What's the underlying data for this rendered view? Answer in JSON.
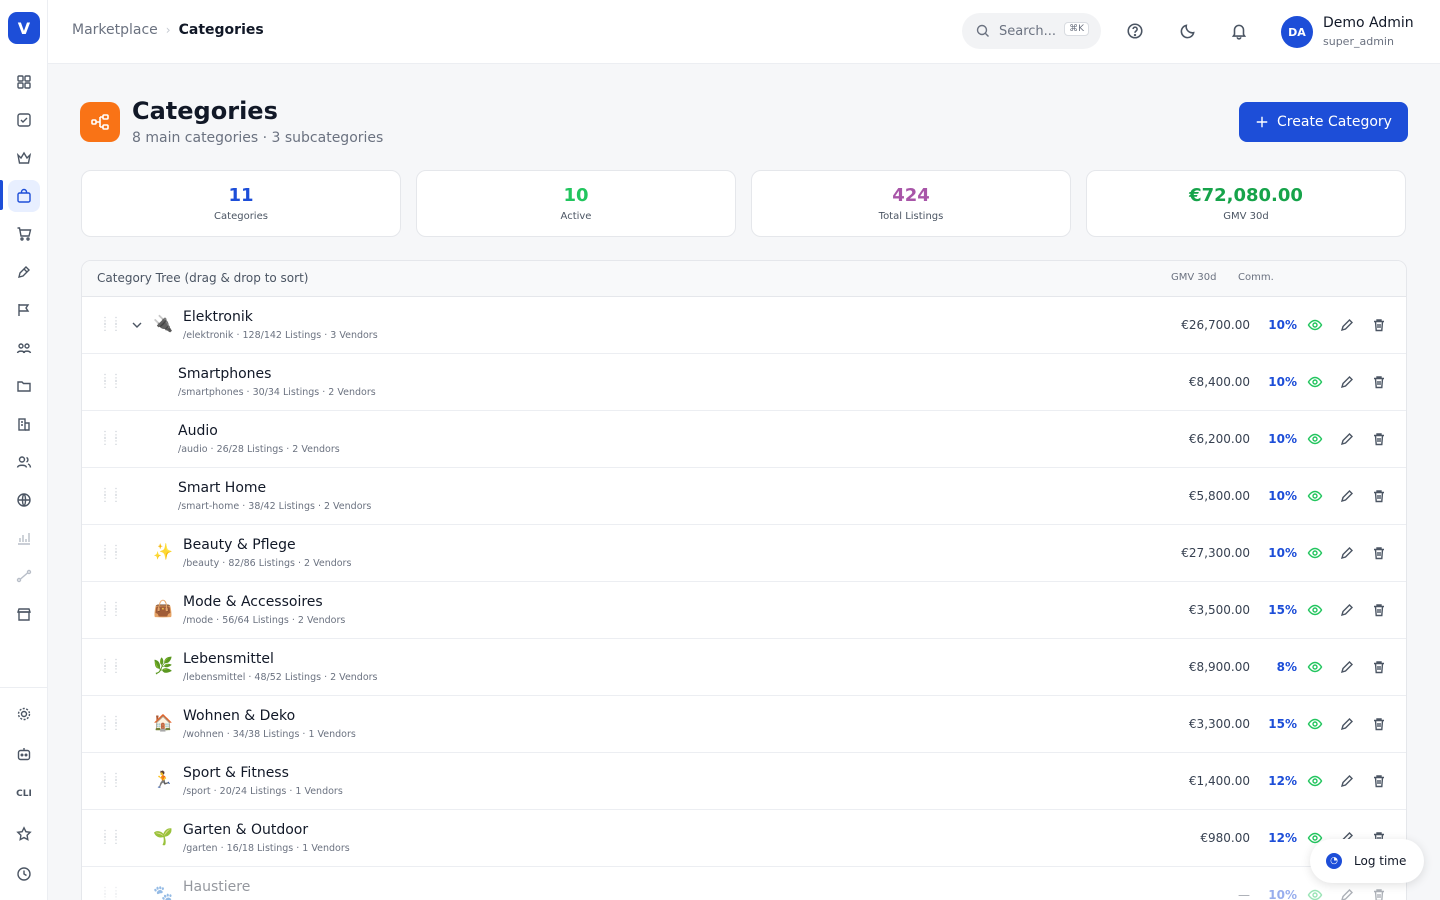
{
  "brand": {
    "logo_letter": "V",
    "accent": "#1d4ed8"
  },
  "sidebar": {
    "items": [
      {
        "name": "dashboard-grid-icon"
      },
      {
        "name": "tasks-check-icon"
      },
      {
        "name": "crown-icon"
      },
      {
        "name": "marketplace-bag-icon",
        "active": true
      },
      {
        "name": "cart-icon"
      },
      {
        "name": "pen-icon"
      },
      {
        "name": "campaign-flag-icon"
      },
      {
        "name": "team-users-icon"
      },
      {
        "name": "folder-icon"
      },
      {
        "name": "buildings-icon"
      },
      {
        "name": "people-icon"
      },
      {
        "name": "globe-icon"
      },
      {
        "name": "analytics-chart-icon",
        "muted": true
      },
      {
        "name": "route-icon",
        "muted": true
      },
      {
        "name": "store-icon"
      }
    ],
    "bottom": [
      {
        "name": "settings-gear-icon"
      },
      {
        "name": "bot-icon"
      },
      {
        "name": "cli-icon",
        "label": "CLI"
      },
      {
        "name": "star-icon"
      },
      {
        "name": "clock-icon"
      }
    ]
  },
  "topbar": {
    "breadcrumb": {
      "parent": "Marketplace",
      "current": "Categories"
    },
    "search": {
      "placeholder": "Search...",
      "shortcut": "⌘K"
    },
    "user": {
      "initials": "DA",
      "name": "Demo Admin",
      "role": "super_admin"
    }
  },
  "header": {
    "title": "Categories",
    "subtitle": "8 main categories · 3 subcategories",
    "create_button": "Create Category"
  },
  "stats": [
    {
      "value": "11",
      "label": "Categories",
      "color": "#1d4ed8"
    },
    {
      "value": "10",
      "label": "Active",
      "color": "#22c55e"
    },
    {
      "value": "424",
      "label": "Total Listings",
      "color": "#a855a8"
    },
    {
      "value": "€72,080.00",
      "label": "GMV 30d",
      "color": "#16a34a"
    }
  ],
  "tree": {
    "title": "Category Tree (drag & drop to sort)",
    "col_gmv": "GMV 30d",
    "col_comm": "Comm.",
    "rows": [
      {
        "emoji": "🔌",
        "name": "Elektronik",
        "meta": "/elektronik · 128/142 Listings · 3 Vendors",
        "gmv": "€26,700.00",
        "comm": "10%",
        "expandable": true,
        "level": 0
      },
      {
        "emoji": "",
        "name": "Smartphones",
        "meta": "/smartphones · 30/34 Listings · 2 Vendors",
        "gmv": "€8,400.00",
        "comm": "10%",
        "level": 1
      },
      {
        "emoji": "",
        "name": "Audio",
        "meta": "/audio · 26/28 Listings · 2 Vendors",
        "gmv": "€6,200.00",
        "comm": "10%",
        "level": 1
      },
      {
        "emoji": "",
        "name": "Smart Home",
        "meta": "/smart-home · 38/42 Listings · 2 Vendors",
        "gmv": "€5,800.00",
        "comm": "10%",
        "level": 1
      },
      {
        "emoji": "✨",
        "name": "Beauty & Pflege",
        "meta": "/beauty · 82/86 Listings · 2 Vendors",
        "gmv": "€27,300.00",
        "comm": "10%",
        "level": 0
      },
      {
        "emoji": "👜",
        "name": "Mode & Accessoires",
        "meta": "/mode · 56/64 Listings · 2 Vendors",
        "gmv": "€3,500.00",
        "comm": "15%",
        "level": 0
      },
      {
        "emoji": "🌿",
        "name": "Lebensmittel",
        "meta": "/lebensmittel · 48/52 Listings · 2 Vendors",
        "gmv": "€8,900.00",
        "comm": "8%",
        "level": 0
      },
      {
        "emoji": "🏠",
        "name": "Wohnen & Deko",
        "meta": "/wohnen · 34/38 Listings · 1 Vendors",
        "gmv": "€3,300.00",
        "comm": "15%",
        "level": 0
      },
      {
        "emoji": "🏃",
        "name": "Sport & Fitness",
        "meta": "/sport · 20/24 Listings · 1 Vendors",
        "gmv": "€1,400.00",
        "comm": "12%",
        "level": 0
      },
      {
        "emoji": "🌱",
        "name": "Garten & Outdoor",
        "meta": "/garten · 16/18 Listings · 1 Vendors",
        "gmv": "€980.00",
        "comm": "12%",
        "level": 0
      },
      {
        "emoji": "🐾",
        "name": "Haustiere",
        "meta": "",
        "gmv": "—",
        "comm": "10%",
        "level": 0,
        "inactive": true
      }
    ]
  },
  "log_time": {
    "label": "Log time"
  }
}
